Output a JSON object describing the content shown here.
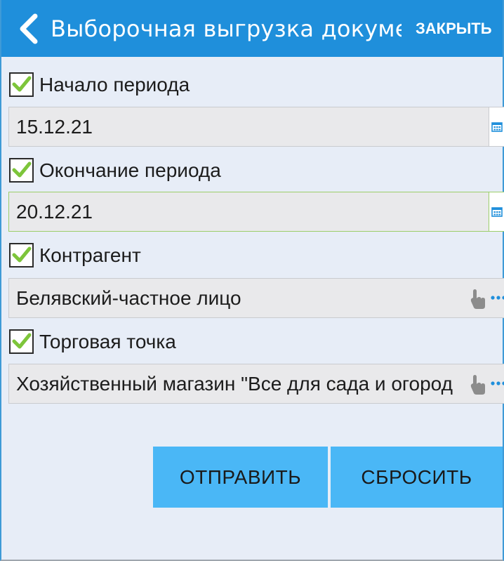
{
  "header": {
    "back_icon": "chevron-left-icon",
    "title": "Выборочная выгрузка докумен...",
    "close_label": "ЗАКРЫТЬ"
  },
  "form": {
    "period_start": {
      "label": "Начало периода",
      "checked": true,
      "value": "15.12.21",
      "icon": "calendar-icon"
    },
    "period_end": {
      "label": "Окончание периода",
      "checked": true,
      "value": "20.12.21",
      "icon": "calendar-icon"
    },
    "counterparty": {
      "label": "Контрагент",
      "checked": true,
      "value": "Белявский-частное лицо",
      "icons": [
        "touch-icon",
        "more-icon"
      ]
    },
    "outlet": {
      "label": "Торговая точка",
      "checked": true,
      "value": "Хозяйственный магазин \"Все для сада и огород",
      "icons": [
        "touch-icon",
        "more-icon"
      ]
    }
  },
  "actions": {
    "send_label": "ОТПРАВИТЬ",
    "reset_label": "СБРОСИТЬ"
  },
  "colors": {
    "appbar": "#1f8fdb",
    "background": "#e7edf7",
    "button": "#4ab7f6",
    "checkmark": "#7dc53a",
    "icon_accent": "#1f8fdb"
  }
}
